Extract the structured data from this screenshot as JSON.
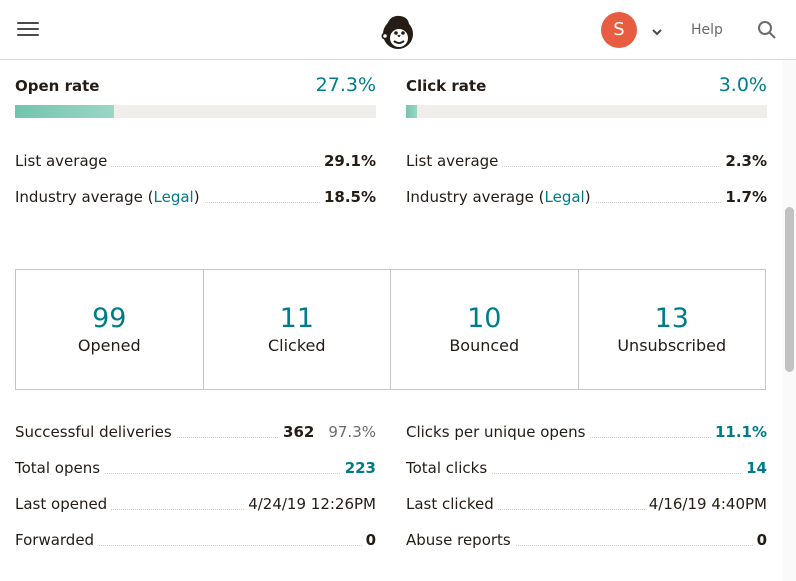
{
  "header": {
    "avatar_initial": "S",
    "help_label": "Help"
  },
  "open_rate": {
    "title": "Open rate",
    "value": "27.3%",
    "progress": 0.273,
    "list_average_label": "List average",
    "list_average_value": "29.1%",
    "industry_label_prefix": "Industry average (",
    "industry_link": "Legal",
    "industry_label_suffix": ")",
    "industry_value": "18.5%"
  },
  "click_rate": {
    "title": "Click rate",
    "value": "3.0%",
    "progress": 0.03,
    "list_average_label": "List average",
    "list_average_value": "2.3%",
    "industry_label_prefix": "Industry average (",
    "industry_link": "Legal",
    "industry_label_suffix": ")",
    "industry_value": "1.7%"
  },
  "summary_boxes": [
    {
      "number": "99",
      "label": "Opened"
    },
    {
      "number": "11",
      "label": "Clicked"
    },
    {
      "number": "10",
      "label": "Bounced"
    },
    {
      "number": "13",
      "label": "Unsubscribed"
    }
  ],
  "left_stats": {
    "successful_deliveries_label": "Successful deliveries",
    "successful_deliveries_value": "362",
    "successful_deliveries_pct": "97.3%",
    "total_opens_label": "Total opens",
    "total_opens_value": "223",
    "last_opened_label": "Last opened",
    "last_opened_value": "4/24/19 12:26PM",
    "forwarded_label": "Forwarded",
    "forwarded_value": "0"
  },
  "right_stats": {
    "clicks_per_unique_label": "Clicks per unique opens",
    "clicks_per_unique_value": "11.1%",
    "total_clicks_label": "Total clicks",
    "total_clicks_value": "14",
    "last_clicked_label": "Last clicked",
    "last_clicked_value": "4/16/19 4:40PM",
    "abuse_reports_label": "Abuse reports",
    "abuse_reports_value": "0"
  },
  "colors": {
    "accent": "#007c89",
    "avatar": "#e85c41",
    "bar_fill": "#72c4ae",
    "bar_track": "#efeeea"
  }
}
